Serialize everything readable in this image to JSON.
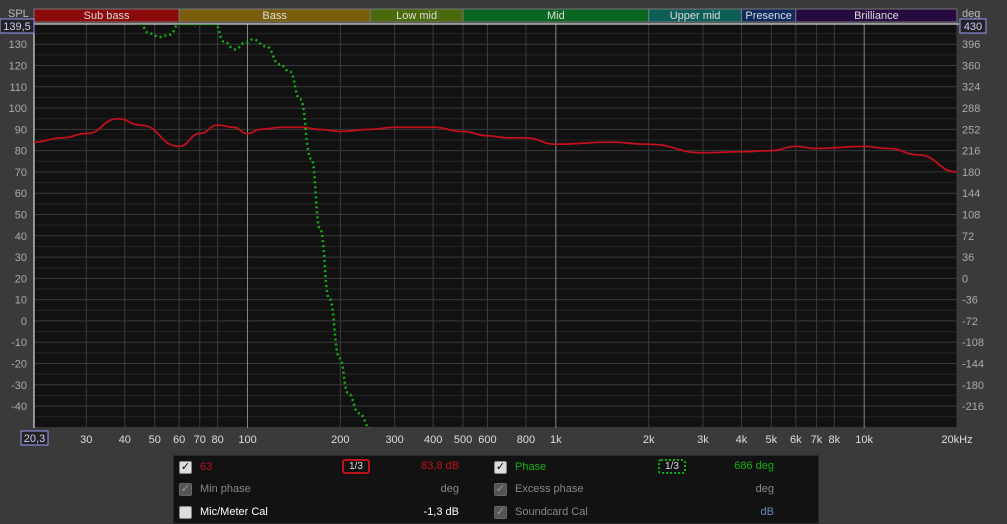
{
  "chart_data": {
    "type": "line",
    "title": "",
    "ylabel": "SPL",
    "ylabel_right": "deg",
    "xlim": [
      20.3,
      20000
    ],
    "ylim": [
      -50.3,
      139.5
    ],
    "ylim_right": [
      -253,
      430
    ],
    "xscale": "log",
    "grid": true,
    "x_min_label": "20,3",
    "y_max_label": "139,5",
    "y_right_max_label": "430",
    "x_ticks": [
      [
        30,
        "30"
      ],
      [
        40,
        "40"
      ],
      [
        50,
        "50"
      ],
      [
        60,
        "60"
      ],
      [
        70,
        "70"
      ],
      [
        80,
        "80"
      ],
      [
        100,
        "100"
      ],
      [
        200,
        "200"
      ],
      [
        300,
        "300"
      ],
      [
        400,
        "400"
      ],
      [
        500,
        "500"
      ],
      [
        600,
        "600"
      ],
      [
        800,
        "800"
      ],
      [
        1000,
        "1k"
      ],
      [
        2000,
        "2k"
      ],
      [
        3000,
        "3k"
      ],
      [
        4000,
        "4k"
      ],
      [
        5000,
        "5k"
      ],
      [
        6000,
        "6k"
      ],
      [
        7000,
        "7k"
      ],
      [
        8000,
        "8k"
      ],
      [
        10000,
        "10k"
      ],
      [
        20000,
        "20kHz"
      ]
    ],
    "y_ticks": [
      130,
      120,
      110,
      100,
      90,
      80,
      70,
      60,
      50,
      40,
      30,
      20,
      10,
      0,
      -10,
      -20,
      -30,
      -40
    ],
    "y_right_ticks": [
      396,
      360,
      324,
      288,
      252,
      216,
      180,
      144,
      108,
      72,
      36,
      0,
      -36,
      -72,
      -108,
      -144,
      -180,
      -216
    ],
    "bands": [
      {
        "name": "Sub bass",
        "from": 20.3,
        "to": 60,
        "color": "#8b0a0a"
      },
      {
        "name": "Bass",
        "from": 60,
        "to": 250,
        "color": "#7a5e0c"
      },
      {
        "name": "Low mid",
        "from": 250,
        "to": 500,
        "color": "#4a6a0c"
      },
      {
        "name": "Mid",
        "from": 500,
        "to": 2000,
        "color": "#0a6620"
      },
      {
        "name": "Upper mid",
        "from": 2000,
        "to": 4000,
        "color": "#0e5e58"
      },
      {
        "name": "Presence",
        "from": 4000,
        "to": 6000,
        "color": "#0e2a5e"
      },
      {
        "name": "Brilliance",
        "from": 6000,
        "to": 20000,
        "color": "#260a40"
      }
    ],
    "series": [
      {
        "name": "63",
        "axis": "left",
        "color": "#c0101a",
        "style": "solid",
        "x": [
          20.3,
          25,
          30,
          38,
          45,
          60,
          70,
          80,
          90,
          100,
          110,
          130,
          150,
          170,
          200,
          250,
          300,
          400,
          500,
          600,
          700,
          800,
          1000,
          1500,
          2000,
          3000,
          4000,
          5000,
          6000,
          7000,
          10000,
          12000,
          15000,
          20000
        ],
        "y": [
          84,
          86,
          88,
          95,
          92,
          82,
          88,
          92,
          91,
          88,
          90,
          91,
          91,
          90,
          89,
          90,
          91,
          91,
          89,
          87,
          86,
          86,
          83,
          84,
          83,
          79,
          79.5,
          80,
          82,
          81,
          82,
          81,
          78,
          70
        ]
      },
      {
        "name": "Phase",
        "axis": "right",
        "color": "#12b012",
        "style": "dotted",
        "x": [
          44.8,
          48,
          52,
          56,
          60,
          78.4,
          84,
          91,
          98,
          104,
          115,
          127,
          137,
          148,
          161,
          172,
          184,
          199,
          212,
          230,
          250
        ],
        "y": [
          430,
          414,
          408,
          412,
          430,
          430,
          400,
          387,
          398,
          404,
          392,
          362,
          350,
          303,
          202,
          83,
          -34,
          -135,
          -194,
          -228,
          -253
        ]
      }
    ]
  },
  "legend": {
    "rows": [
      {
        "label": "63",
        "value": "83,8 dB",
        "checked": true,
        "color": "#c0101a",
        "smoothing": "1/3"
      },
      {
        "label": "Min phase",
        "value": "deg",
        "checked": true,
        "disabled": true
      },
      {
        "label": "Mic/Meter Cal",
        "value": "-1,3 dB",
        "checked": false
      },
      {
        "label": "Phase",
        "value": "686 deg",
        "checked": true,
        "color": "#12b012",
        "smoothing": "1/3"
      },
      {
        "label": "Excess phase",
        "value": "deg",
        "checked": true,
        "disabled": true
      },
      {
        "label": "Soundcard Cal",
        "value": "dB",
        "checked": true,
        "disabled": true
      }
    ]
  }
}
